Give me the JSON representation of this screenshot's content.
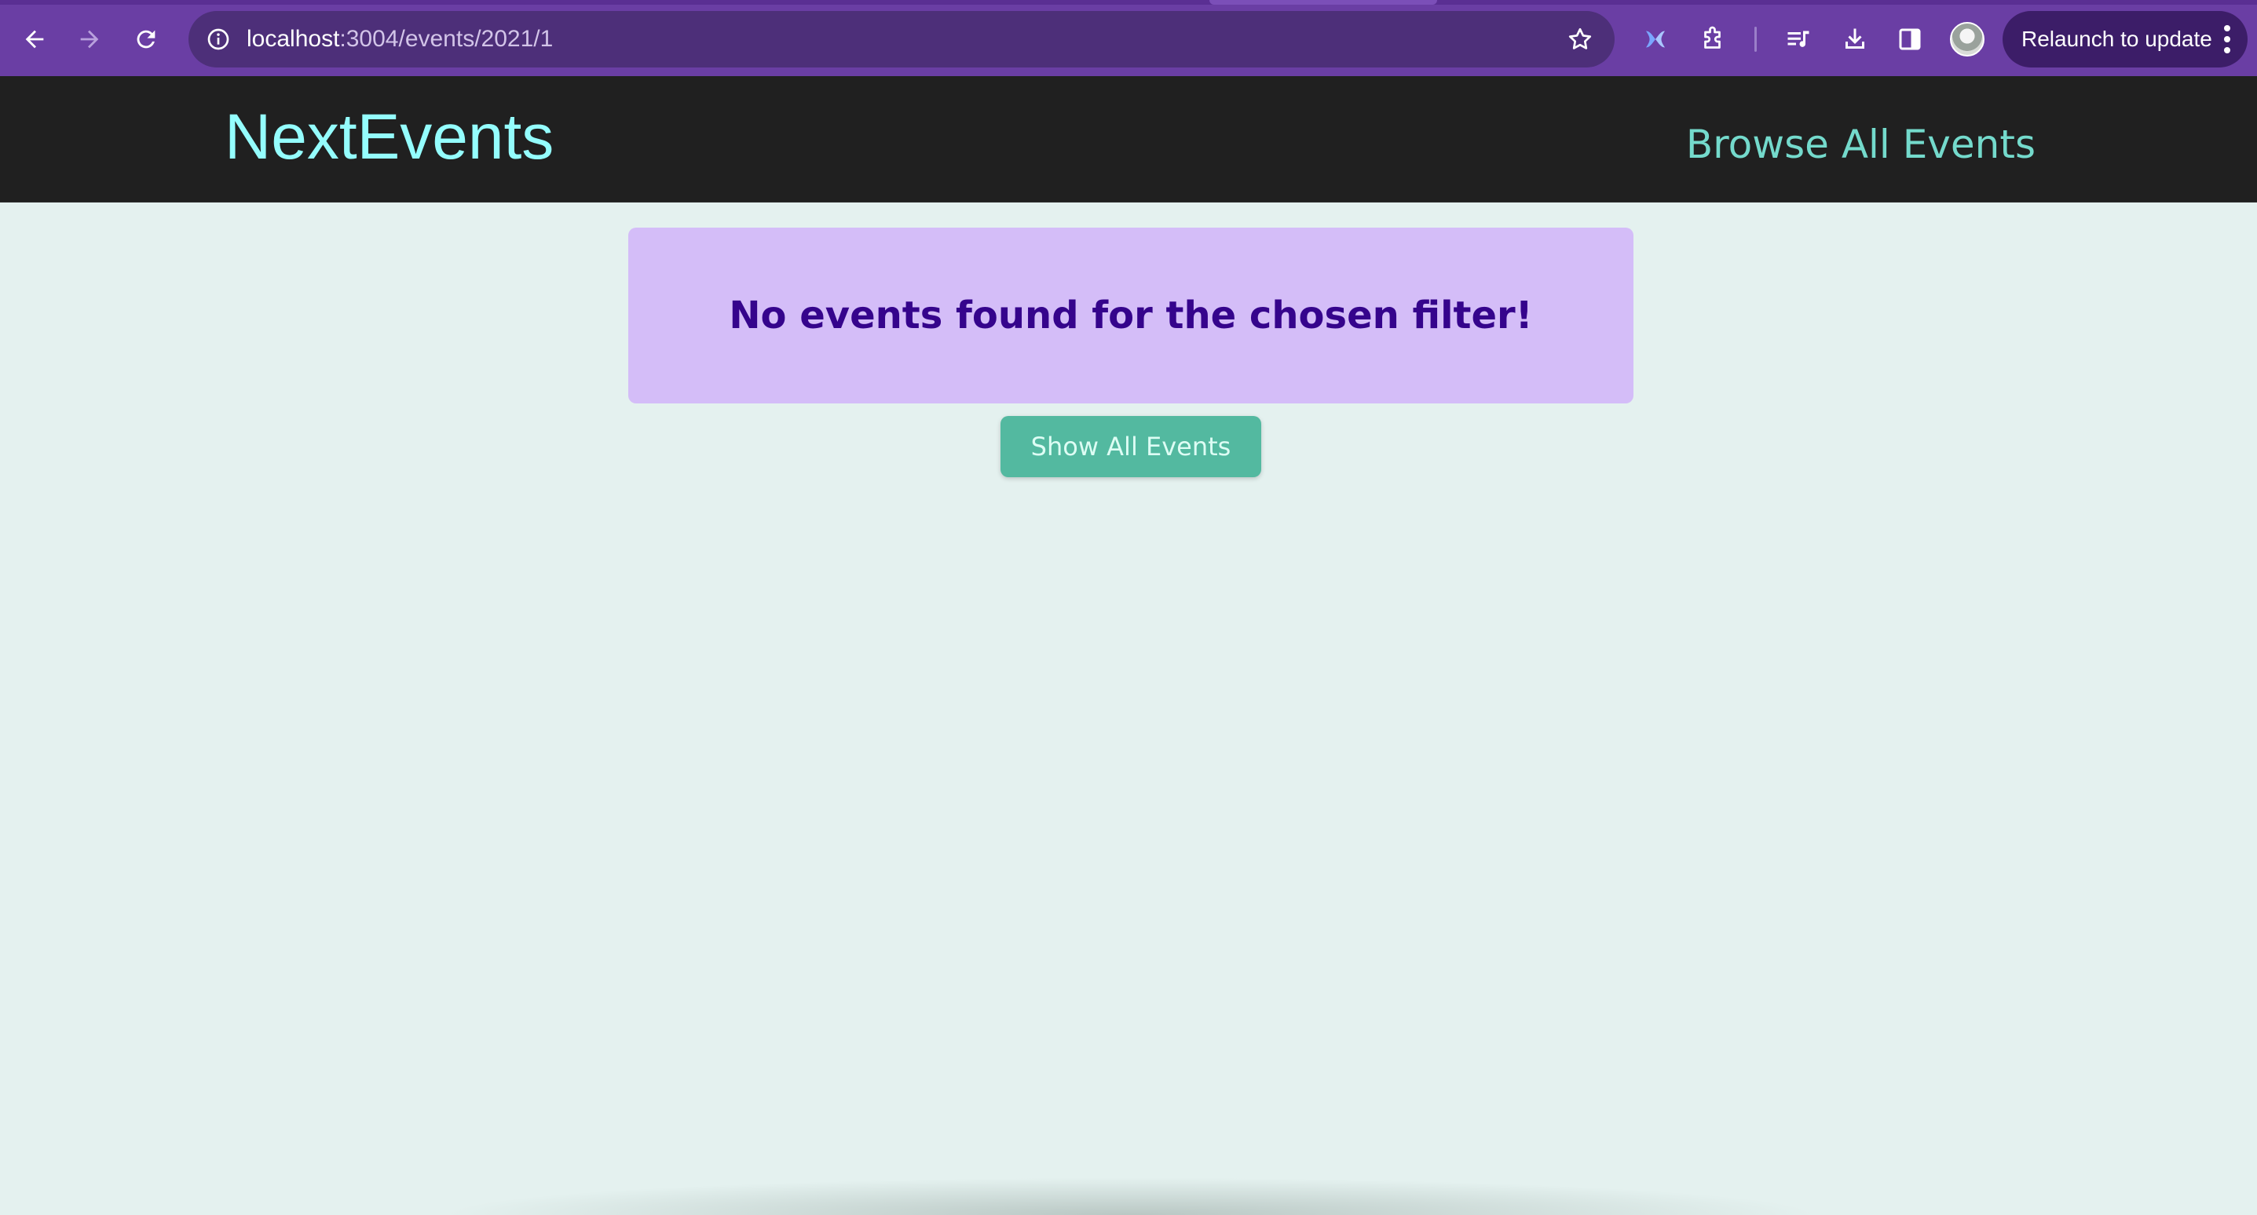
{
  "browser": {
    "url_host": "localhost",
    "url_path": ":3004/events/2021/1",
    "relaunch_label": "Relaunch to update",
    "icons": {
      "back": "arrow-left-icon",
      "forward": "arrow-right-icon",
      "reload": "reload-icon",
      "site_info": "info-icon",
      "bookmark": "star-icon",
      "extension_app": "extension-app-icon",
      "extensions": "puzzle-piece-icon",
      "media": "media-queue-icon",
      "downloads": "download-icon",
      "side_panel": "side-panel-icon",
      "profile": "profile-avatar",
      "menu": "kebab-menu-icon"
    },
    "colors": {
      "frame": "#6a3ea4",
      "omnibox": "#4d2f79",
      "relaunch": "#3c1d68"
    }
  },
  "site": {
    "logo": "NextEvents",
    "nav_link": "Browse All Events",
    "colors": {
      "header_bg": "#202020",
      "logo": "#94fdfd",
      "nav_link": "#74dacc",
      "page_bg": "#e4f1ef"
    }
  },
  "main": {
    "alert_message": "No events found for the chosen filter!",
    "show_all_button": "Show All Events",
    "colors": {
      "alert_bg": "#d4bdf8",
      "alert_text": "#35048c",
      "button_bg": "#53b9a0",
      "button_text": "#ddfdf4"
    }
  }
}
